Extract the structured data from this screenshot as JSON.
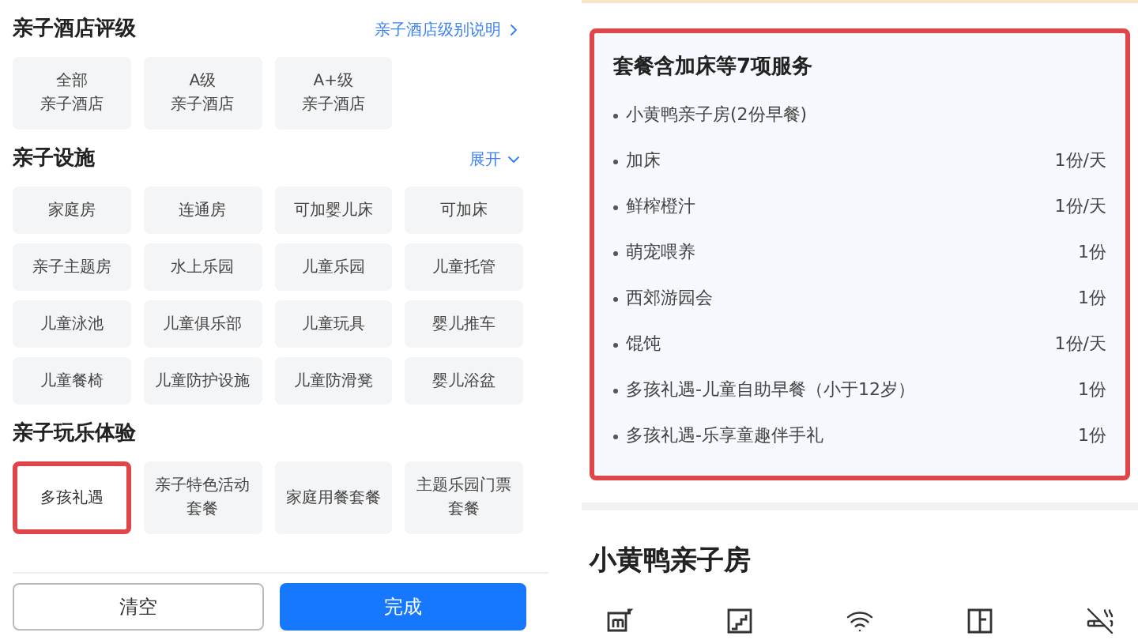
{
  "filter_panel": {
    "sections": [
      {
        "title": "亲子酒店评级",
        "link": {
          "text": "亲子酒店级别说明",
          "kind": "chevron-right"
        },
        "options": [
          {
            "lines": [
              "全部",
              "亲子酒店"
            ],
            "selected": false
          },
          {
            "lines": [
              "A级",
              "亲子酒店"
            ],
            "selected": false
          },
          {
            "lines": [
              "A+级",
              "亲子酒店"
            ],
            "selected": false
          }
        ]
      },
      {
        "title": "亲子设施",
        "link": {
          "text": "展开",
          "kind": "chevron-down"
        },
        "options": [
          {
            "lines": [
              "家庭房"
            ],
            "selected": false
          },
          {
            "lines": [
              "连通房"
            ],
            "selected": false
          },
          {
            "lines": [
              "可加婴儿床"
            ],
            "selected": false
          },
          {
            "lines": [
              "可加床"
            ],
            "selected": false
          },
          {
            "lines": [
              "亲子主题房"
            ],
            "selected": false
          },
          {
            "lines": [
              "水上乐园"
            ],
            "selected": false
          },
          {
            "lines": [
              "儿童乐园"
            ],
            "selected": false
          },
          {
            "lines": [
              "儿童托管"
            ],
            "selected": false
          },
          {
            "lines": [
              "儿童泳池"
            ],
            "selected": false
          },
          {
            "lines": [
              "儿童俱乐部"
            ],
            "selected": false
          },
          {
            "lines": [
              "儿童玩具"
            ],
            "selected": false
          },
          {
            "lines": [
              "婴儿推车"
            ],
            "selected": false
          },
          {
            "lines": [
              "儿童餐椅"
            ],
            "selected": false
          },
          {
            "lines": [
              "儿童防护设施"
            ],
            "selected": false
          },
          {
            "lines": [
              "儿童防滑凳"
            ],
            "selected": false
          },
          {
            "lines": [
              "婴儿浴盆"
            ],
            "selected": false
          }
        ]
      },
      {
        "title": "亲子玩乐体验",
        "options": [
          {
            "lines": [
              "多孩礼遇"
            ],
            "selected": true
          },
          {
            "lines": [
              "亲子特色活动",
              "套餐"
            ],
            "selected": false
          },
          {
            "lines": [
              "家庭用餐套餐"
            ],
            "selected": false
          },
          {
            "lines": [
              "主题乐园门票",
              "套餐"
            ],
            "selected": false
          }
        ]
      }
    ],
    "buttons": [
      {
        "label": "清空",
        "kind": "secondary"
      },
      {
        "label": "完成",
        "kind": "primary"
      }
    ]
  },
  "package": {
    "title": "套餐含加床等7项服务",
    "items": [
      {
        "name": "小黄鸭亲子房(2份早餐)"
      },
      {
        "name": "加床",
        "quantity": "1份/天"
      },
      {
        "name": "鲜榨橙汁",
        "quantity": "1份/天"
      },
      {
        "name": "萌宠喂养",
        "quantity": "1份"
      },
      {
        "name": "西郊游园会",
        "quantity": "1份"
      },
      {
        "name": "馄饨",
        "quantity": "1份/天"
      },
      {
        "name": "多孩礼遇-儿童自助早餐（小于12岁）",
        "quantity": "1份"
      },
      {
        "name": "多孩礼遇-乐享童趣伴手礼",
        "quantity": "1份"
      }
    ]
  },
  "room": {
    "title": "小黄鸭亲子房",
    "amenities": [
      {
        "kind": "area"
      },
      {
        "kind": "floor"
      },
      {
        "kind": "wifi"
      },
      {
        "kind": "window"
      },
      {
        "kind": "no-smoking"
      }
    ]
  }
}
